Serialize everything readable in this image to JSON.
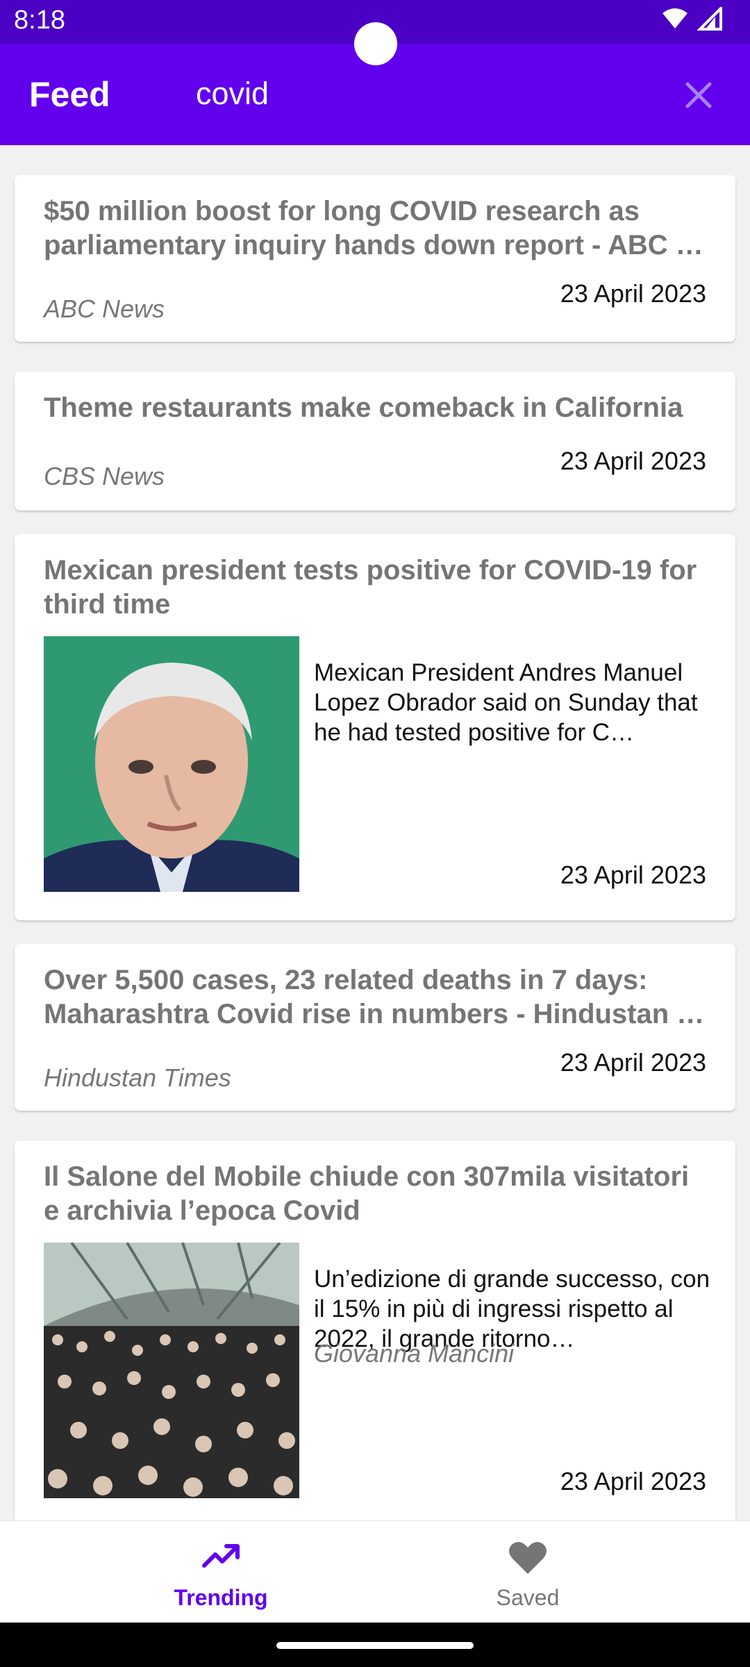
{
  "status_bar": {
    "time": "8:18"
  },
  "app_bar": {
    "title": "Feed",
    "query": "covid"
  },
  "articles": [
    {
      "headline": "$50 million boost for long COVID research as parliamentary inquiry hands down report - ABC …",
      "source": "ABC News",
      "date": "23 April 2023"
    },
    {
      "headline": "Theme restaurants make comeback in California",
      "source": "CBS News",
      "date": "23 April 2023"
    },
    {
      "headline": "Mexican president tests positive for COVID-19 for third time",
      "description": "Mexican President Andres Manuel Lopez Obrador said on Sunday that he had tested positive for C…",
      "date": "23 April 2023",
      "image": "portrait-photo"
    },
    {
      "headline": "Over 5,500 cases, 23 related deaths in 7 days: Maharashtra Covid rise in numbers - Hindustan …",
      "source": "Hindustan Times",
      "date": "23 April 2023"
    },
    {
      "headline": "Il Salone del Mobile chiude con 307mila visitatori e archivia l’epoca Covid",
      "description": "Un’edizione di grande successo, con il 15% in più di ingressi rispetto al 2022, il grande ritorno…",
      "source": "Giovanna Mancini",
      "date": "23 April 2023",
      "image": "crowd-photo"
    }
  ],
  "bottom_nav": {
    "items": [
      {
        "label": "Trending",
        "icon": "trending-up-icon",
        "active": true
      },
      {
        "label": "Saved",
        "icon": "heart-icon",
        "active": false
      }
    ]
  },
  "colors": {
    "primary": "#6200ee",
    "status_bar": "#4b00c4"
  }
}
